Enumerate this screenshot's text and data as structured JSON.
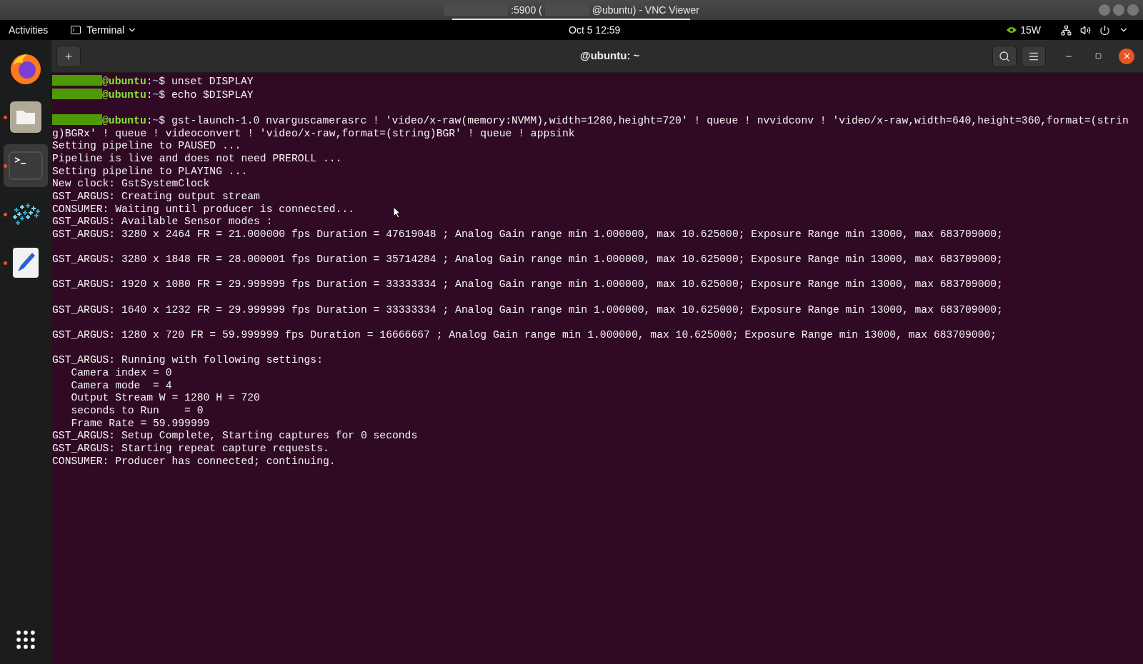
{
  "vnc_window": {
    "title_before": ":5900 (",
    "title_after": "@ubuntu) - VNC Viewer"
  },
  "top_bar": {
    "activities": "Activities",
    "app_menu": "Terminal",
    "clock": "Oct 5  12:59",
    "power_mode": "15W"
  },
  "dock": [
    {
      "kind": "browser",
      "running": false,
      "selected": false
    },
    {
      "kind": "files",
      "running": true,
      "selected": false
    },
    {
      "kind": "terminal",
      "running": true,
      "selected": true
    },
    {
      "kind": "network",
      "running": true,
      "selected": false
    },
    {
      "kind": "editor",
      "running": true,
      "selected": false
    }
  ],
  "terminal": {
    "title": "@ubuntu: ~",
    "separator": ":",
    "lines": [
      {
        "kind": "prompt",
        "host": "@ubuntu",
        "path": "~",
        "command": "$ unset DISPLAY"
      },
      {
        "kind": "prompt",
        "host": "@ubuntu",
        "path": "~",
        "command": "$ echo $DISPLAY"
      },
      {
        "kind": "blank"
      },
      {
        "kind": "prompt",
        "host": "@ubuntu",
        "path": "~",
        "command": "$ gst-launch-1.0 nvarguscamerasrc ! 'video/x-raw(memory:NVMM),width=1280,height=720' ! queue ! nvvidconv ! 'video/x-raw,width=640,height=360,format=(string)BGRx' ! queue ! videoconvert ! 'video/x-raw,format=(string)BGR' ! queue ! appsink"
      },
      {
        "kind": "output",
        "text": "Setting pipeline to PAUSED ..."
      },
      {
        "kind": "output",
        "text": "Pipeline is live and does not need PREROLL ..."
      },
      {
        "kind": "output",
        "text": "Setting pipeline to PLAYING ..."
      },
      {
        "kind": "output",
        "text": "New clock: GstSystemClock"
      },
      {
        "kind": "output",
        "text": "GST_ARGUS: Creating output stream"
      },
      {
        "kind": "output",
        "text": "CONSUMER: Waiting until producer is connected..."
      },
      {
        "kind": "output",
        "text": "GST_ARGUS: Available Sensor modes :"
      },
      {
        "kind": "output",
        "text": "GST_ARGUS: 3280 x 2464 FR = 21.000000 fps Duration = 47619048 ; Analog Gain range min 1.000000, max 10.625000; Exposure Range min 13000, max 683709000;"
      },
      {
        "kind": "blank"
      },
      {
        "kind": "output",
        "text": "GST_ARGUS: 3280 x 1848 FR = 28.000001 fps Duration = 35714284 ; Analog Gain range min 1.000000, max 10.625000; Exposure Range min 13000, max 683709000;"
      },
      {
        "kind": "blank"
      },
      {
        "kind": "output",
        "text": "GST_ARGUS: 1920 x 1080 FR = 29.999999 fps Duration = 33333334 ; Analog Gain range min 1.000000, max 10.625000; Exposure Range min 13000, max 683709000;"
      },
      {
        "kind": "blank"
      },
      {
        "kind": "output",
        "text": "GST_ARGUS: 1640 x 1232 FR = 29.999999 fps Duration = 33333334 ; Analog Gain range min 1.000000, max 10.625000; Exposure Range min 13000, max 683709000;"
      },
      {
        "kind": "blank"
      },
      {
        "kind": "output",
        "text": "GST_ARGUS: 1280 x 720 FR = 59.999999 fps Duration = 16666667 ; Analog Gain range min 1.000000, max 10.625000; Exposure Range min 13000, max 683709000;"
      },
      {
        "kind": "blank"
      },
      {
        "kind": "output",
        "text": "GST_ARGUS: Running with following settings:"
      },
      {
        "kind": "output",
        "text": "   Camera index = 0"
      },
      {
        "kind": "output",
        "text": "   Camera mode  = 4"
      },
      {
        "kind": "output",
        "text": "   Output Stream W = 1280 H = 720"
      },
      {
        "kind": "output",
        "text": "   seconds to Run    = 0"
      },
      {
        "kind": "output",
        "text": "   Frame Rate = 59.999999"
      },
      {
        "kind": "output",
        "text": "GST_ARGUS: Setup Complete, Starting captures for 0 seconds"
      },
      {
        "kind": "output",
        "text": "GST_ARGUS: Starting repeat capture requests."
      },
      {
        "kind": "output",
        "text": "CONSUMER: Producer has connected; continuing."
      }
    ]
  }
}
